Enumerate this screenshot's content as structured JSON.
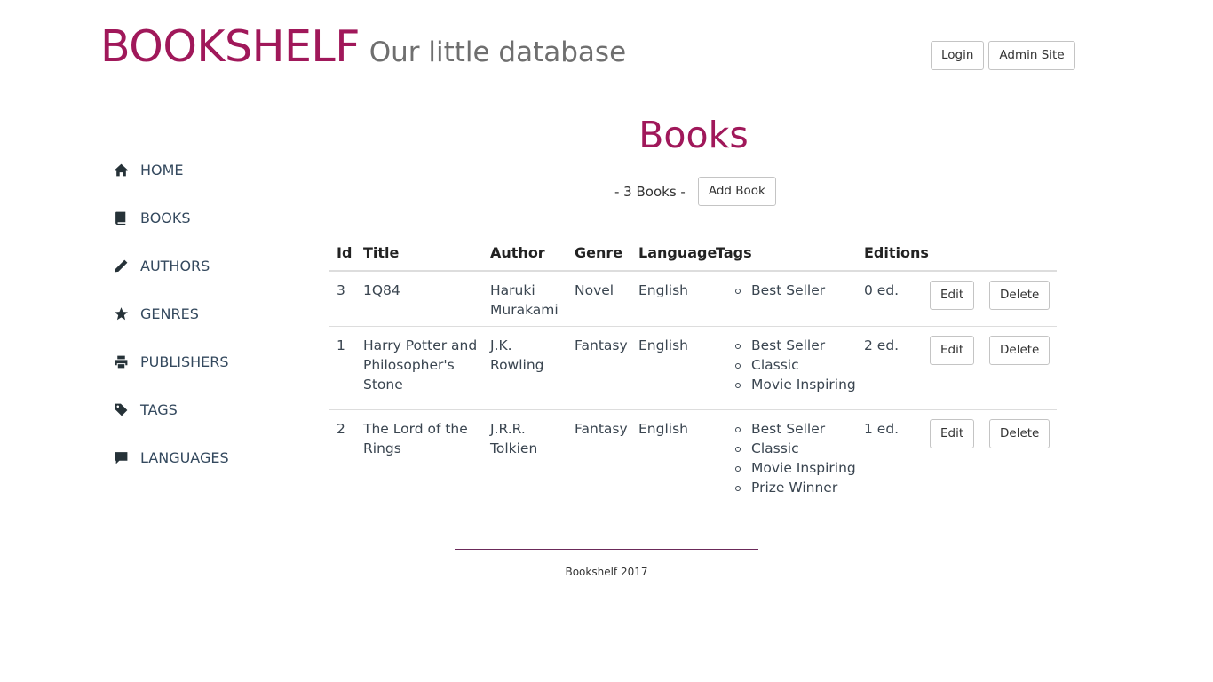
{
  "header": {
    "brand": "BOOKSHELF",
    "tagline": "Our little database",
    "login_label": "Login",
    "admin_label": "Admin Site"
  },
  "sidebar": {
    "items": [
      {
        "label": "HOME",
        "icon": "home-icon"
      },
      {
        "label": "BOOKS",
        "icon": "book-icon"
      },
      {
        "label": "AUTHORS",
        "icon": "pencil-icon"
      },
      {
        "label": "GENRES",
        "icon": "star-icon"
      },
      {
        "label": "PUBLISHERS",
        "icon": "print-icon"
      },
      {
        "label": "TAGS",
        "icon": "tag-icon"
      },
      {
        "label": "LANGUAGES",
        "icon": "comment-icon"
      }
    ]
  },
  "main": {
    "title": "Books",
    "count_text": "- 3 Books -",
    "add_label": "Add Book",
    "columns": [
      "Id",
      "Title",
      "Author",
      "Genre",
      "Language",
      "Tags",
      "Editions"
    ],
    "edit_label": "Edit",
    "delete_label": "Delete",
    "rows": [
      {
        "id": "3",
        "title": "1Q84",
        "author": "Haruki Murakami",
        "genre": "Novel",
        "language": "English",
        "tags": [
          "Best Seller"
        ],
        "editions": "0 ed."
      },
      {
        "id": "1",
        "title": "Harry Potter and Philosopher's Stone",
        "author": "J.K. Rowling",
        "genre": "Fantasy",
        "language": "English",
        "tags": [
          "Best Seller",
          "Classic",
          "Movie Inspiring"
        ],
        "editions": "2 ed."
      },
      {
        "id": "2",
        "title": "The Lord of the Rings",
        "author": "J.R.R. Tolkien",
        "genre": "Fantasy",
        "language": "English",
        "tags": [
          "Best Seller",
          "Classic",
          "Movie Inspiring",
          "Prize Winner"
        ],
        "editions": "1 ed."
      }
    ]
  },
  "footer": {
    "text": "Bookshelf 2017"
  },
  "colors": {
    "brand": "#a0185a",
    "tagline": "#6f6f6f",
    "text": "#3a4550",
    "footer_line": "#6b2a5a"
  }
}
